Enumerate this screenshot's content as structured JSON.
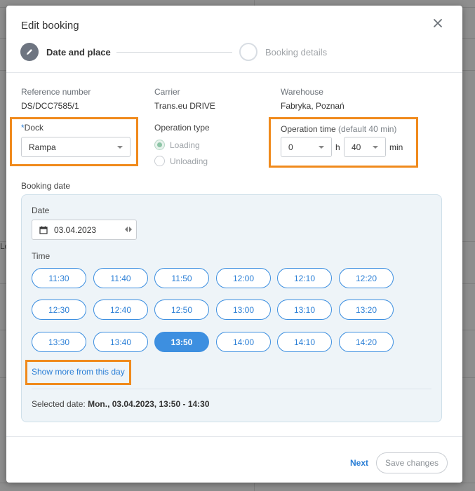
{
  "modal": {
    "title": "Edit booking",
    "close_icon": "close-icon"
  },
  "stepper": {
    "steps": [
      {
        "label": "Date and place",
        "state": "active",
        "icon": "pencil-icon"
      },
      {
        "label": "Booking details",
        "state": "pending"
      }
    ]
  },
  "info": {
    "reference_label": "Reference number",
    "reference_value": "DS/DCC7585/1",
    "carrier_label": "Carrier",
    "carrier_value": "Trans.eu DRIVE",
    "warehouse_label": "Warehouse",
    "warehouse_value": "Fabryka, Poznań"
  },
  "dock": {
    "required_mark": "*",
    "label": "Dock",
    "value": "Rampa"
  },
  "operation_type": {
    "label": "Operation type",
    "options": [
      {
        "label": "Loading",
        "checked": true
      },
      {
        "label": "Unloading",
        "checked": false
      }
    ]
  },
  "operation_time": {
    "label": "Operation time",
    "hint": "(default 40 min)",
    "hours": "0",
    "hours_unit": "h",
    "minutes": "40",
    "minutes_unit": "min"
  },
  "booking_date": {
    "label": "Booking date",
    "date_label": "Date",
    "date_value": "03.04.2023",
    "time_label": "Time",
    "slots": [
      "11:30",
      "11:40",
      "11:50",
      "12:00",
      "12:10",
      "12:20",
      "12:30",
      "12:40",
      "12:50",
      "13:00",
      "13:10",
      "13:20",
      "13:30",
      "13:40",
      "13:50",
      "14:00",
      "14:10",
      "14:20"
    ],
    "selected_slot": "13:50",
    "show_more": "Show more from this day",
    "selected_prefix": "Selected date:",
    "selected_value": "Mon., 03.04.2023, 13:50 - 14:30"
  },
  "footer": {
    "next_label": "Next",
    "save_label": "Save changes"
  },
  "colors": {
    "accent": "#3d8fe0",
    "highlight": "#f08a1c",
    "panel": "#eef4f8"
  }
}
